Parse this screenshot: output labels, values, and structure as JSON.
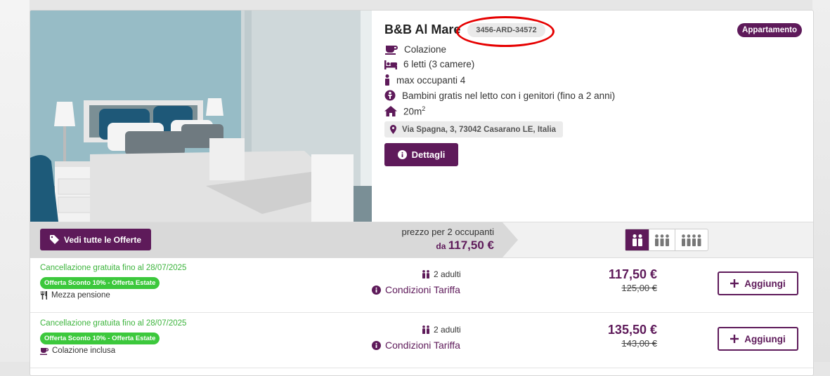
{
  "property": {
    "name": "B&B Al Mare",
    "code": "3456-ARD-34572",
    "type_badge": "Appartamento",
    "features": {
      "breakfast": "Colazione",
      "beds": "6 letti (3 camere)",
      "max_occupants": "max occupanti 4",
      "children": "Bambini gratis nel letto con i genitori (fino a 2 anni)",
      "area_value": "20m",
      "area_sup": "2"
    },
    "address": "Via Spagna, 3, 73042 Casarano LE, Italia",
    "details_button": "Dettagli"
  },
  "offers_bar": {
    "all_offers_button": "Vedi tutte le Offerte",
    "price_label": "prezzo per 2 occupanti",
    "from_label": "da",
    "from_price": "117,50 €",
    "occupancy_options": [
      {
        "icon": "two-persons-icon",
        "active": true
      },
      {
        "icon": "three-persons-icon",
        "active": false
      },
      {
        "icon": "four-persons-icon",
        "active": false
      }
    ]
  },
  "offers": [
    {
      "cancellation": "Cancellazione gratuita fino al 28/07/2025",
      "promo": "Offerta Sconto 10% - Offerta Estate",
      "meal": "Mezza pensione",
      "meal_icon": "cutlery-icon",
      "adults": "2 adulti",
      "conditions": "Condizioni Tariffa",
      "price": "117,50 €",
      "old_price": "125,00 €",
      "add_label": "Aggiungi"
    },
    {
      "cancellation": "Cancellazione gratuita fino al 28/07/2025",
      "promo": "Offerta Sconto 10% - Offerta Estate",
      "meal": "Colazione inclusa",
      "meal_icon": "coffee-icon",
      "adults": "2 adulti",
      "conditions": "Condizioni Tariffa",
      "price": "135,50 €",
      "old_price": "143,00 €",
      "add_label": "Aggiungi"
    }
  ],
  "colors": {
    "primary": "#5e1a5a",
    "success": "#3cb43c",
    "highlight_ring": "#e60000"
  }
}
